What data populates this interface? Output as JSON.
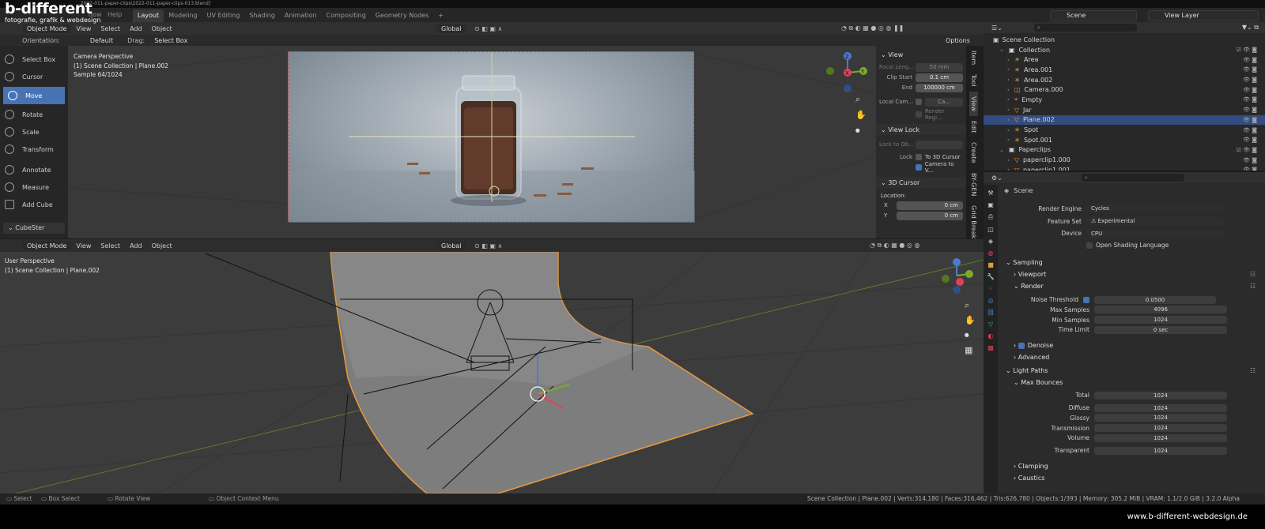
{
  "window": {
    "title": "...2022-011-paper-clips\\2022-011-paper-clips-013.blend]"
  },
  "logo": {
    "line1": "b-different",
    "line2": "fotografie, grafik & webdesign"
  },
  "top_menu": {
    "window": "dow",
    "help": "Help"
  },
  "workspace_tabs": [
    "Layout",
    "Modeling",
    "UV Editing",
    "Shading",
    "Animation",
    "Compositing",
    "Geometry Nodes",
    "+"
  ],
  "scene_selector": "Scene",
  "view_layer": "View Layer",
  "upper_viewport": {
    "mode": "Object Mode",
    "menus": [
      "View",
      "Select",
      "Add",
      "Object"
    ],
    "orientation_label": "Orientation:",
    "orientation_value": "Default",
    "drag_label": "Drag:",
    "drag_value": "Select Box",
    "transform_orientation": "Global",
    "options": "Options",
    "overlay_text": [
      "Camera Perspective",
      "(1) Scene Collection | Plane.002",
      "Sample 64/1024"
    ]
  },
  "tools": [
    {
      "label": "Select Box",
      "icon": "select-box-icon"
    },
    {
      "label": "Cursor",
      "icon": "cursor-icon"
    },
    {
      "label": "Move",
      "icon": "move-icon",
      "active": true
    },
    {
      "label": "Rotate",
      "icon": "rotate-icon"
    },
    {
      "label": "Scale",
      "icon": "scale-icon"
    },
    {
      "label": "Transform",
      "icon": "transform-icon"
    },
    {
      "label": "Annotate",
      "icon": "annotate-icon"
    },
    {
      "label": "Measure",
      "icon": "measure-icon"
    },
    {
      "label": "Add Cube",
      "icon": "add-cube-icon"
    }
  ],
  "cubester": "CubeSter",
  "npanel": {
    "view_header": "View",
    "focal_length_label": "Focal Leng...",
    "focal_length": "50 mm",
    "clip_start_label": "Clip Start",
    "clip_start": "0.1 cm",
    "end_label": "End",
    "end": "100000 cm",
    "local_camera_label": "Local Cam...",
    "local_camera_value": "Ca...",
    "render_region": "Render Regi...",
    "view_lock_header": "View Lock",
    "lock_to_object_label": "Lock to Ob...",
    "lock_label": "Lock",
    "to_3d_cursor": "To 3D Cursor",
    "camera_to_view": "Camera to V...",
    "cursor_header": "3D Cursor",
    "location_label": "Location:",
    "x_label": "X",
    "x_value": "0 cm",
    "y_label": "Y",
    "y_value": "0 cm",
    "tabs": [
      "Item",
      "Tool",
      "View",
      "Edit",
      "Create",
      "BY-GEN",
      "Grid Break"
    ]
  },
  "lower_viewport": {
    "mode": "Object Mode",
    "menus": [
      "View",
      "Select",
      "Add",
      "Object"
    ],
    "transform_orientation": "Global",
    "overlay_text": [
      "User Perspective",
      "(1) Scene Collection | Plane.002"
    ]
  },
  "outliner": {
    "root": "Scene Collection",
    "items": [
      {
        "label": "Collection",
        "depth": 1,
        "kind": "collection"
      },
      {
        "label": "Area",
        "depth": 2,
        "kind": "light"
      },
      {
        "label": "Area.001",
        "depth": 2,
        "kind": "light"
      },
      {
        "label": "Area.002",
        "depth": 2,
        "kind": "light"
      },
      {
        "label": "Camera.000",
        "depth": 2,
        "kind": "camera"
      },
      {
        "label": "Empty",
        "depth": 2,
        "kind": "empty"
      },
      {
        "label": "Jar",
        "depth": 2,
        "kind": "mesh"
      },
      {
        "label": "Plane.002",
        "depth": 2,
        "kind": "mesh",
        "selected": true
      },
      {
        "label": "Spot",
        "depth": 2,
        "kind": "light"
      },
      {
        "label": "Spot.001",
        "depth": 2,
        "kind": "light"
      },
      {
        "label": "Paperclips",
        "depth": 1,
        "kind": "collection"
      },
      {
        "label": "paperclip1.000",
        "depth": 2,
        "kind": "mesh"
      },
      {
        "label": "paperclip1.001",
        "depth": 2,
        "kind": "mesh"
      }
    ]
  },
  "properties": {
    "context": "Scene",
    "render_engine_label": "Render Engine",
    "render_engine": "Cycles",
    "feature_set_label": "Feature Set",
    "feature_set": "Experimental",
    "device_label": "Device",
    "device": "CPU",
    "open_shading_language": "Open Shading Language",
    "sampling": "Sampling",
    "viewport": "Viewport",
    "render": "Render",
    "noise_threshold_label": "Noise Threshold",
    "noise_threshold": "0.0500",
    "max_samples_label": "Max Samples",
    "max_samples": "4096",
    "min_samples_label": "Min Samples",
    "min_samples": "1024",
    "time_limit_label": "Time Limit",
    "time_limit": "0 sec",
    "denoise": "Denoise",
    "advanced": "Advanced",
    "light_paths": "Light Paths",
    "max_bounces": "Max Bounces",
    "total_label": "Total",
    "total": "1024",
    "diffuse_label": "Diffuse",
    "diffuse": "1024",
    "glossy_label": "Glossy",
    "glossy": "1024",
    "transmission_label": "Transmission",
    "transmission": "1024",
    "volume_label": "Volume",
    "volume": "1024",
    "transparent_label": "Transparent",
    "transparent": "1024",
    "clamping": "Clamping",
    "caustics": "Caustics"
  },
  "statusbar": {
    "select": "Select",
    "box_select": "Box Select",
    "rotate_view": "Rotate View",
    "context_menu": "Object Context Menu",
    "stats": "Scene Collection | Plane.002 | Verts:314,180 | Faces:316,462 | Tris:626,780 | Objects:1/393 | Memory: 305.2 MiB | VRAM: 1.1/2.0 GiB | 3.2.0 Alpha"
  },
  "watermark": "www.b-different-webdesign.de",
  "colors": {
    "accent": "#4772b3",
    "selected_row": "#334d80",
    "object_outline": "#e89a3a"
  }
}
